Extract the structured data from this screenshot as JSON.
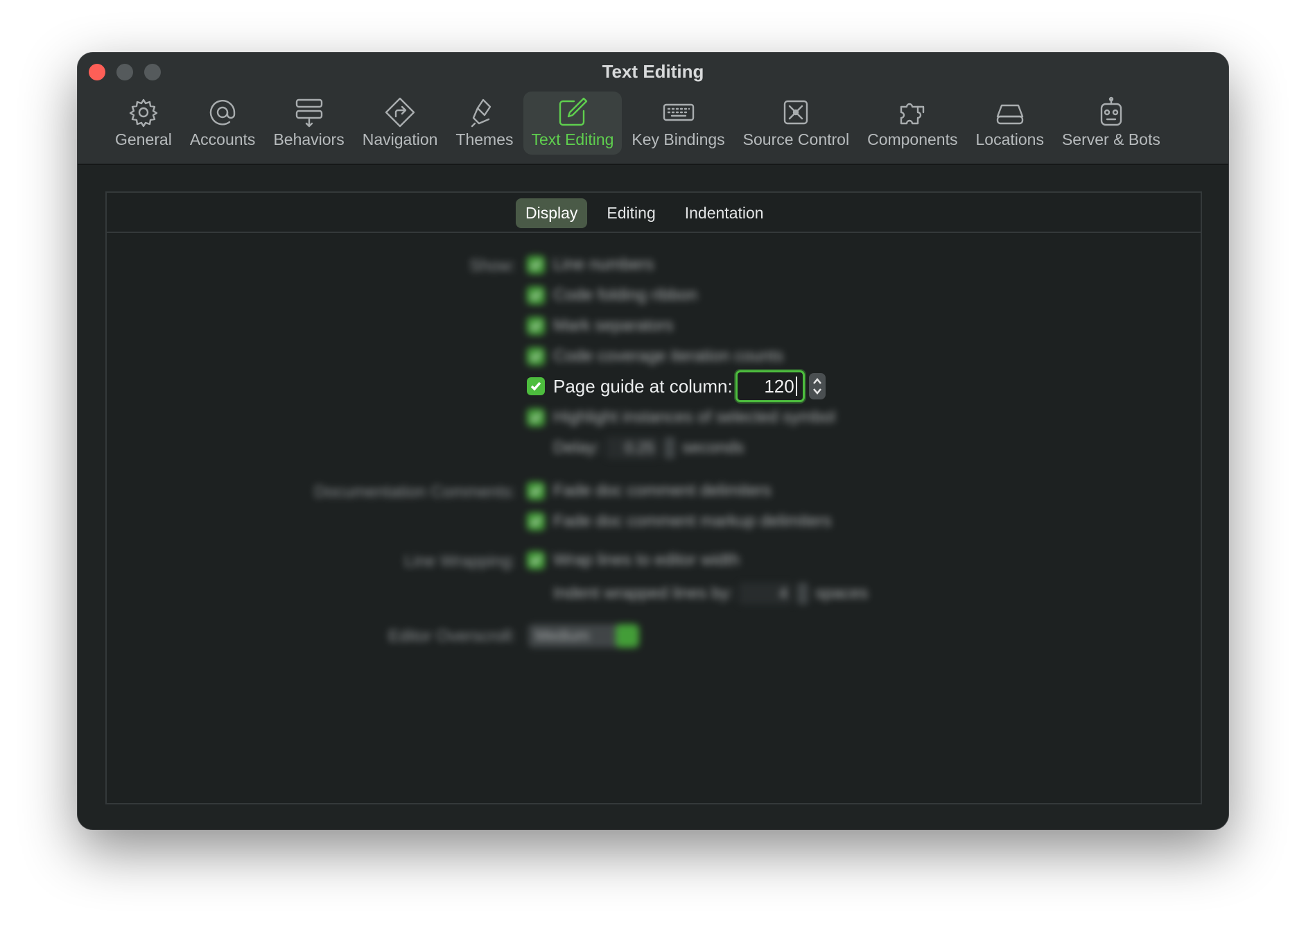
{
  "window": {
    "title": "Text Editing"
  },
  "toolbar": {
    "tabs": [
      {
        "label": "General",
        "icon": "gear-icon"
      },
      {
        "label": "Accounts",
        "icon": "at-sign-icon"
      },
      {
        "label": "Behaviors",
        "icon": "behaviors-icon"
      },
      {
        "label": "Navigation",
        "icon": "navigation-icon"
      },
      {
        "label": "Themes",
        "icon": "paintbrush-icon"
      },
      {
        "label": "Text Editing",
        "icon": "pencil-square-icon",
        "active": true
      },
      {
        "label": "Key Bindings",
        "icon": "keyboard-icon"
      },
      {
        "label": "Source Control",
        "icon": "source-control-icon"
      },
      {
        "label": "Components",
        "icon": "puzzle-piece-icon"
      },
      {
        "label": "Locations",
        "icon": "drive-icon"
      },
      {
        "label": "Server & Bots",
        "icon": "robot-icon"
      }
    ]
  },
  "segments": {
    "display": "Display",
    "editing": "Editing",
    "indentation": "Indentation",
    "selected": "Display"
  },
  "display": {
    "show_label": "Show:",
    "line_numbers": "Line numbers",
    "code_folding_ribbon": "Code folding ribbon",
    "mark_separators": "Mark separators",
    "code_coverage": "Code coverage iteration counts",
    "page_guide_label": "Page guide at column:",
    "page_guide_value": "120",
    "highlight_instances": "Highlight instances of selected symbol",
    "delay_label": "Delay:",
    "delay_value": "0.25",
    "delay_unit": "seconds",
    "doc_comments_label": "Documentation Comments:",
    "fade_delimiters": "Fade doc comment delimiters",
    "fade_markup": "Fade doc comment markup delimiters",
    "line_wrapping_label": "Line Wrapping:",
    "wrap_lines": "Wrap lines to editor width",
    "indent_wrapped_label": "Indent wrapped lines by:",
    "indent_wrapped_value": "4",
    "indent_wrapped_unit": "spaces",
    "overscroll_label": "Editor Overscroll:",
    "overscroll_value": "Medium"
  },
  "colors": {
    "accent": "#4dbd3e",
    "window_bg": "#1f2323",
    "toolbar_bg": "#2e3233",
    "close": "#fe5f57"
  }
}
